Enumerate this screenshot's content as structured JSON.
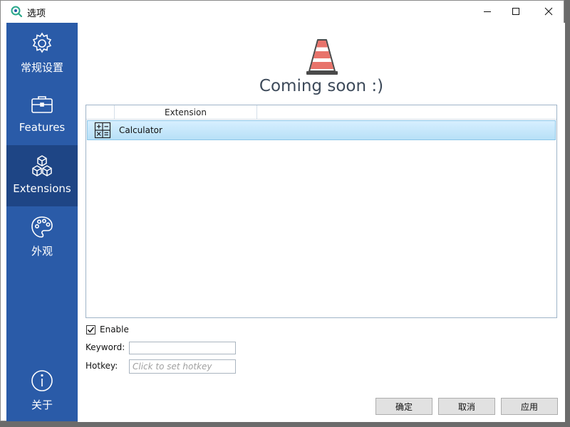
{
  "window": {
    "title": "选项",
    "minimize_icon": "minimize-icon",
    "maximize_icon": "maximize-icon",
    "close_icon": "close-icon"
  },
  "sidebar": {
    "items": [
      {
        "label": "常规设置",
        "icon": "gear-icon",
        "active": false
      },
      {
        "label": "Features",
        "icon": "briefcase-icon",
        "active": false
      },
      {
        "label": "Extensions",
        "icon": "cubes-icon",
        "active": true
      },
      {
        "label": "外观",
        "icon": "palette-icon",
        "active": false
      }
    ],
    "about": {
      "label": "关于",
      "icon": "info-icon"
    }
  },
  "main": {
    "banner_icon": "traffic-cone-icon",
    "banner_text": "Coming soon :)",
    "table": {
      "columns": [
        "Extension"
      ],
      "rows": [
        {
          "name": "Calculator",
          "icon": "calculator-icon",
          "selected": true
        }
      ]
    },
    "enable": {
      "label": "Enable",
      "checked": true
    },
    "keyword": {
      "label": "Keyword:",
      "value": ""
    },
    "hotkey": {
      "label": "Hotkey:",
      "placeholder": "Click to set hotkey"
    }
  },
  "buttons": {
    "ok": "确定",
    "cancel": "取消",
    "apply": "应用"
  },
  "colors": {
    "sidebar": "#2a5ba8",
    "sidebar_active": "#1e4585",
    "row_selected": "#b7e0f7"
  }
}
